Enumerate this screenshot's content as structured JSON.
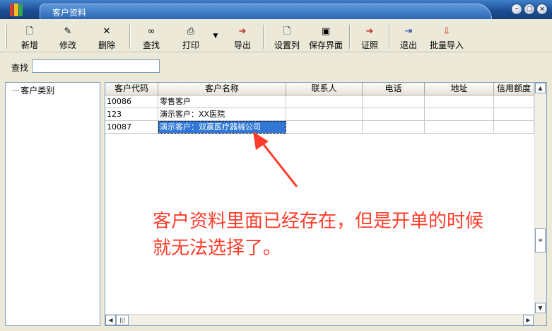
{
  "window": {
    "title": "客户资料",
    "controls": [
      "minimize-icon",
      "restore-icon",
      "close-icon"
    ]
  },
  "toolbar": {
    "buttons": [
      {
        "label": "新增",
        "icon": "new-document-icon"
      },
      {
        "label": "修改",
        "icon": "edit-document-icon"
      },
      {
        "label": "删除",
        "icon": "delete-x-icon"
      },
      {
        "label": "查找",
        "icon": "binoculars-icon"
      },
      {
        "label": "打印",
        "icon": "printer-icon"
      },
      {
        "label": "导出",
        "icon": "export-icon"
      },
      {
        "label": "设置列",
        "icon": "column-settings-icon"
      },
      {
        "label": "保存界面",
        "icon": "save-disk-icon"
      },
      {
        "label": "证照",
        "icon": "license-icon"
      },
      {
        "label": "退出",
        "icon": "exit-door-icon"
      },
      {
        "label": "批量导入",
        "icon": "batch-import-icon"
      }
    ]
  },
  "search": {
    "label": "查找",
    "value": ""
  },
  "tree": {
    "root": "客户类别"
  },
  "grid": {
    "columns": [
      "客户代码",
      "客户名称",
      "联系人",
      "电话",
      "地址",
      "信用额度"
    ],
    "rows": [
      [
        "10086",
        "零售客户",
        "",
        "",
        "",
        ""
      ],
      [
        "123",
        "演示客户：XX医院",
        "",
        "",
        "",
        ""
      ],
      [
        "10087",
        "演示客户：双赢医疗器械公司",
        "",
        "",
        "",
        ""
      ]
    ],
    "selected_row": 2
  },
  "annotation": {
    "line1": "客户资料里面已经存在，但是开单的时候",
    "line2": "就无法选择了。",
    "color": "#ff3c2a"
  }
}
